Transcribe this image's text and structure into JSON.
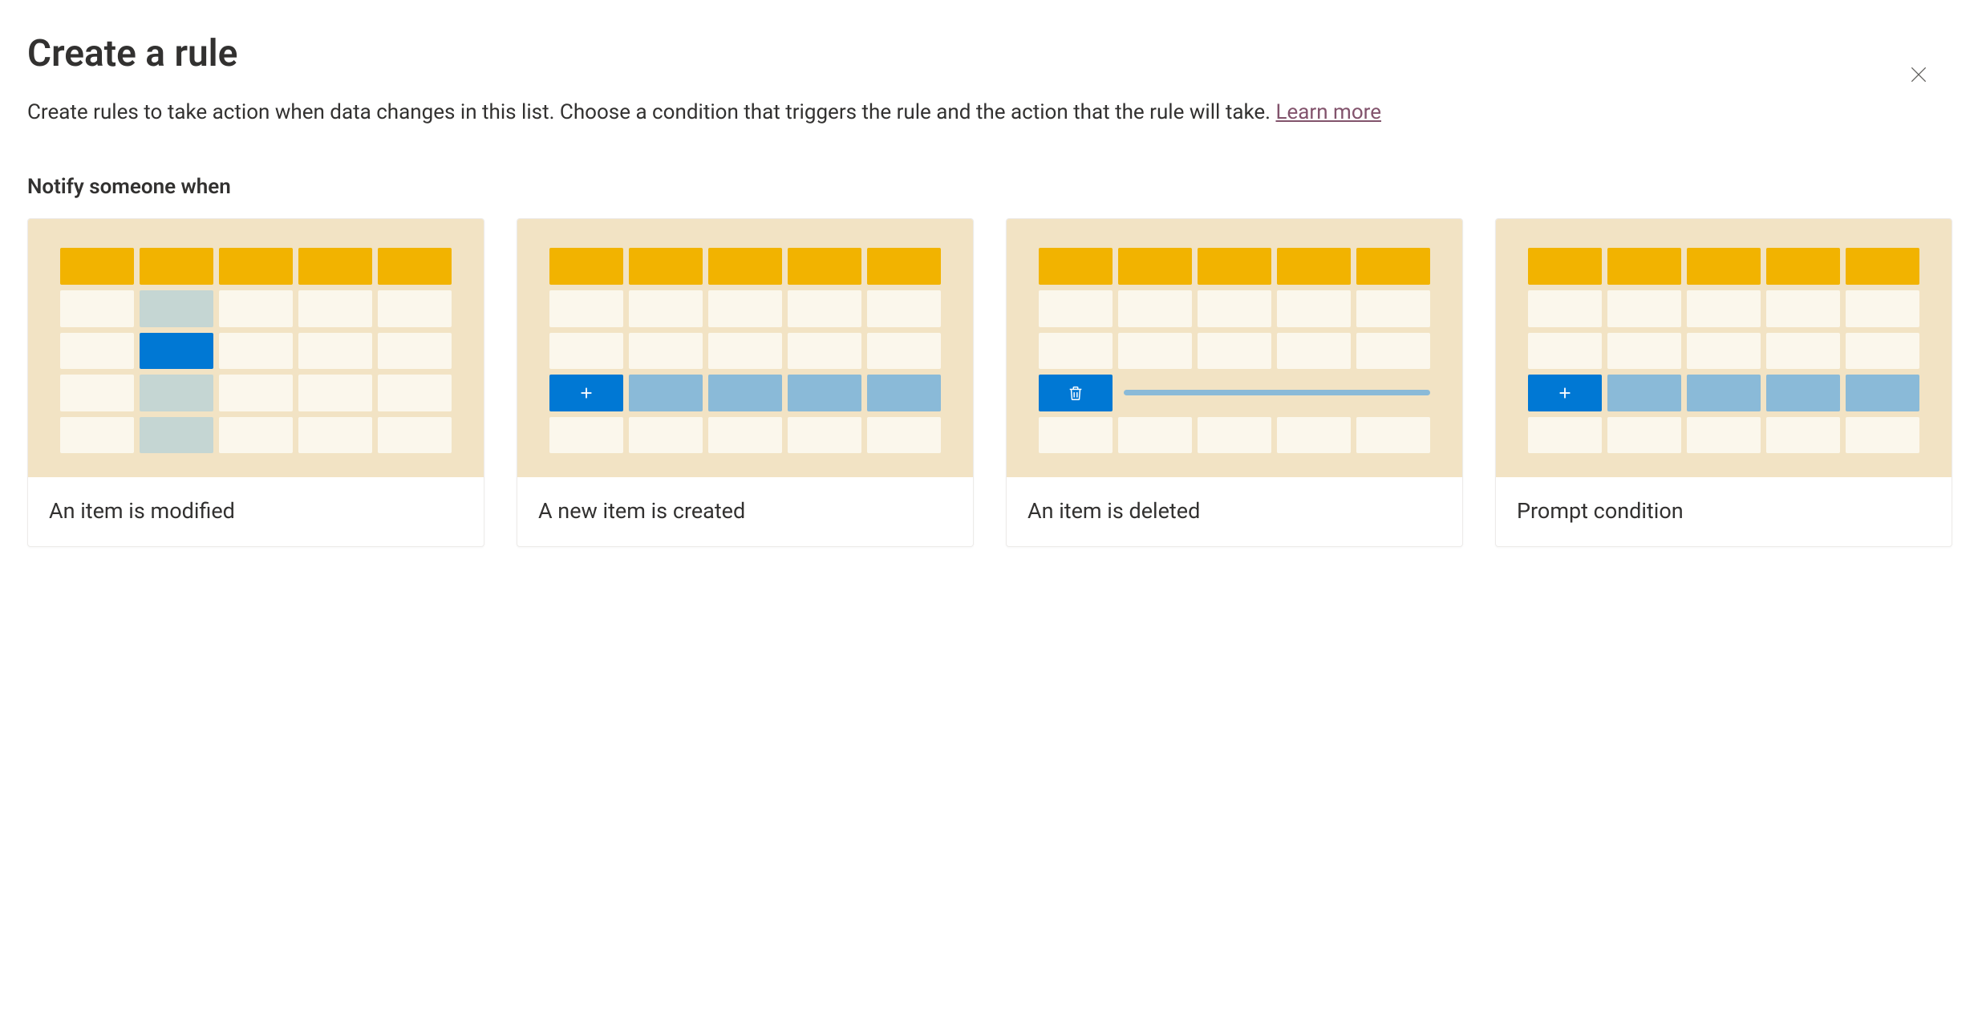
{
  "dialog": {
    "title": "Create a rule",
    "description_pre": "Create rules to take action when data changes in this list. Choose a condition that triggers the rule and the action that the rule will take. ",
    "learn_more": "Learn more",
    "close_label": "Close"
  },
  "section": {
    "notify_label": "Notify someone when"
  },
  "cards": [
    {
      "id": "modified",
      "label": "An item is modified"
    },
    {
      "id": "created",
      "label": "A new item is created"
    },
    {
      "id": "deleted",
      "label": "An item is deleted"
    },
    {
      "id": "prompt",
      "label": "Prompt condition"
    }
  ]
}
